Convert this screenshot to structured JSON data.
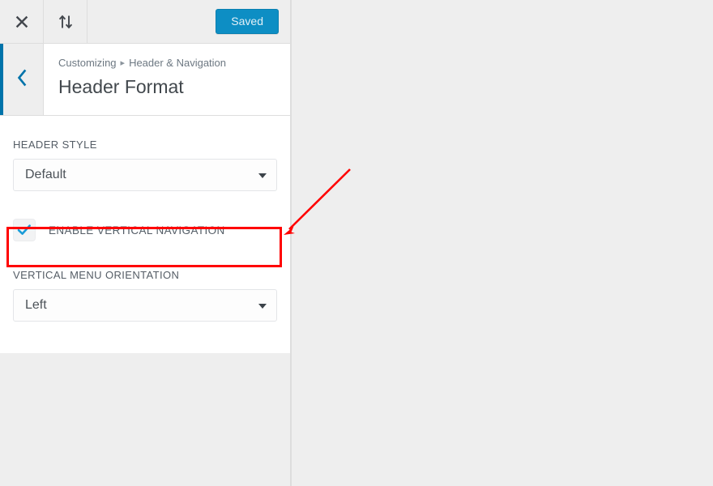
{
  "toolbar": {
    "close_icon": "close-icon",
    "close_label": "Close customizer",
    "devices_icon": "collapse-arrows-icon",
    "devices_label": "Collapse panel",
    "save_label": "Saved"
  },
  "section_header": {
    "back_icon": "chevron-left-icon",
    "back_label": "Back",
    "breadcrumb_root": "Customizing",
    "breadcrumb_separator": "▸",
    "breadcrumb_parent": "Header & Navigation",
    "title": "Header Format"
  },
  "controls": [
    {
      "type": "select",
      "label": "HEADER STYLE",
      "value": "Default",
      "options": [
        "Default"
      ]
    },
    {
      "type": "checkbox",
      "label": "ENABLE VERTICAL NAVIGATION",
      "checked": true,
      "check_icon": "checkmark-icon"
    },
    {
      "type": "select",
      "label": "VERTICAL MENU ORIENTATION",
      "value": "Left",
      "options": [
        "Left"
      ]
    }
  ],
  "annotation": {
    "highlight_color": "#ff0000",
    "arrow_color": "#ff0000",
    "arrow_from": "432,209",
    "arrow_to": "351,289",
    "target": "ENABLE VERTICAL NAVIGATION"
  },
  "colors": {
    "accent_blue": "#0073aa",
    "button_blue": "#0d8ec4",
    "panel_bg": "#ffffff",
    "chrome_bg": "#eeeeee",
    "preview_bg": "#eeeeee",
    "label_text": "#555d66",
    "title_text": "#42484d"
  }
}
